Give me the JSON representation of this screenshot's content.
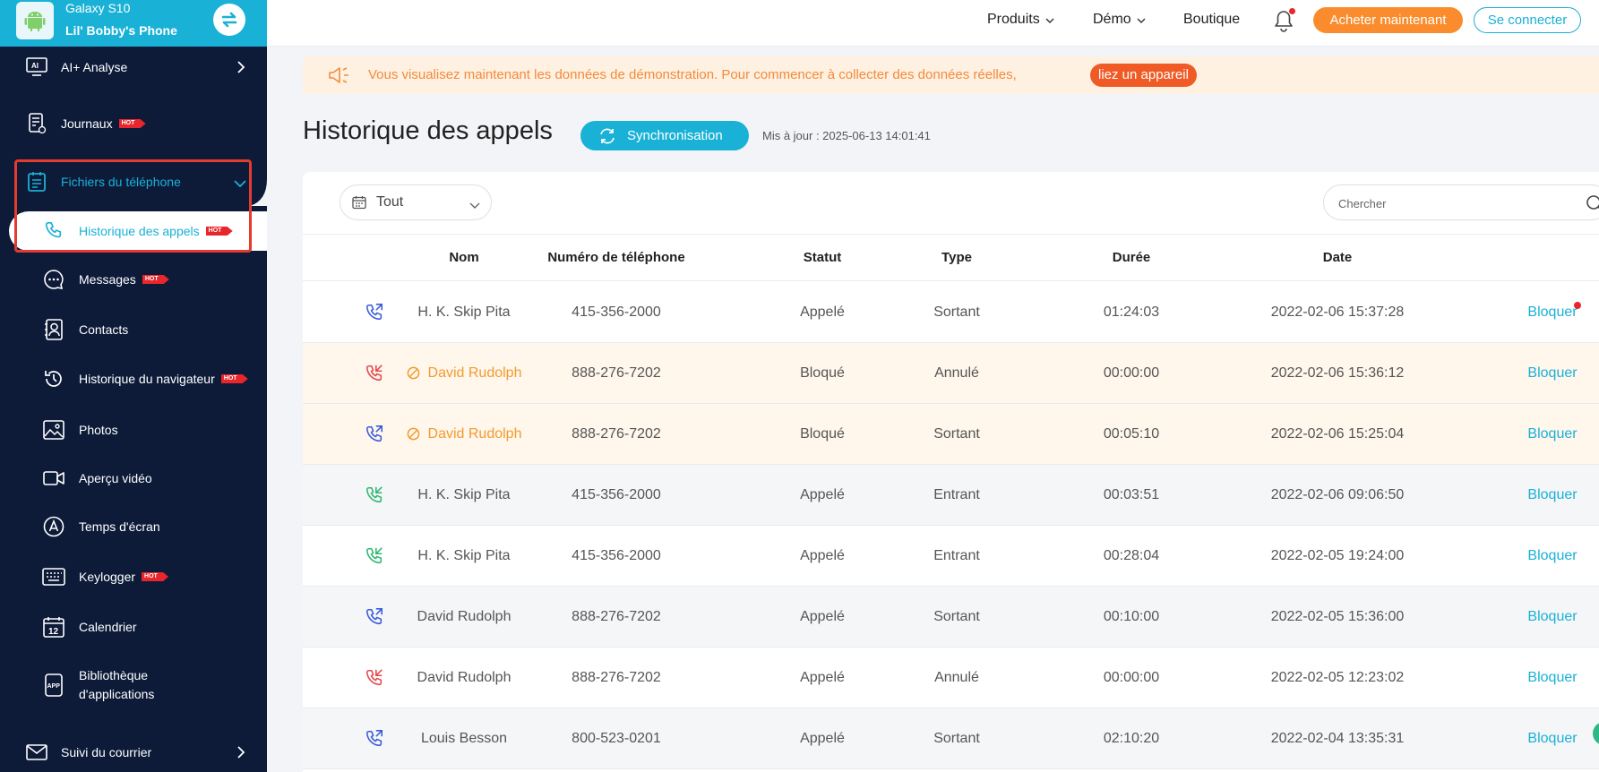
{
  "device": {
    "model": "Galaxy S10",
    "name": "Lil' Bobby's Phone"
  },
  "sidebar": {
    "hot_label": "HOT",
    "ai": "AI+ Analyse",
    "logs": "Journaux",
    "phone_files": "Fichiers du téléphone",
    "sub": {
      "calls": "Historique des appels",
      "messages": "Messages",
      "contacts": "Contacts",
      "browser": "Historique du navigateur",
      "photos": "Photos",
      "video": "Aperçu vidéo",
      "screen_time": "Temps d'écran",
      "keylogger": "Keylogger",
      "calendar": "Calendrier",
      "apps_line1": "Bibliothèque",
      "apps_line2": "d'applications"
    },
    "mail": "Suivi du courrier"
  },
  "topbar": {
    "products": "Produits",
    "demo": "Démo",
    "shop": "Boutique",
    "buy": "Acheter maintenant",
    "login": "Se connecter"
  },
  "banner": {
    "text": "Vous visualisez maintenant les données de démonstration. Pour commencer à collecter des données réelles,",
    "link": "liez un appareil"
  },
  "page": {
    "title": "Historique des appels",
    "sync": "Synchronisation",
    "updated": "Mis à jour : 2025-06-13 14:01:41"
  },
  "filter": {
    "selected": "Tout"
  },
  "search": {
    "placeholder": "Chercher"
  },
  "table": {
    "headers": {
      "name": "Nom",
      "phone": "Numéro de téléphone",
      "status": "Statut",
      "type": "Type",
      "duration": "Durée",
      "date": "Date"
    },
    "action_label": "Bloquer",
    "rows": [
      {
        "dir": "outgoing",
        "name": "H. K. Skip Pita",
        "phone": "415-356-2000",
        "status": "Appelé",
        "type": "Sortant",
        "duration": "01:24:03",
        "date": "2022-02-06 15:37:28",
        "blocked": false
      },
      {
        "dir": "cancelled",
        "name": "David Rudolph",
        "phone": "888-276-7202",
        "status": "Bloqué",
        "type": "Annulé",
        "duration": "00:00:00",
        "date": "2022-02-06 15:36:12",
        "blocked": true
      },
      {
        "dir": "outgoing",
        "name": "David Rudolph",
        "phone": "888-276-7202",
        "status": "Bloqué",
        "type": "Sortant",
        "duration": "00:05:10",
        "date": "2022-02-06 15:25:04",
        "blocked": true
      },
      {
        "dir": "incoming",
        "name": "H. K. Skip Pita",
        "phone": "415-356-2000",
        "status": "Appelé",
        "type": "Entrant",
        "duration": "00:03:51",
        "date": "2022-02-06 09:06:50",
        "blocked": false
      },
      {
        "dir": "incoming",
        "name": "H. K. Skip Pita",
        "phone": "415-356-2000",
        "status": "Appelé",
        "type": "Entrant",
        "duration": "00:28:04",
        "date": "2022-02-05 19:24:00",
        "blocked": false
      },
      {
        "dir": "outgoing",
        "name": "David Rudolph",
        "phone": "888-276-7202",
        "status": "Appelé",
        "type": "Sortant",
        "duration": "00:10:00",
        "date": "2022-02-05 15:36:00",
        "blocked": false
      },
      {
        "dir": "cancelled",
        "name": "David Rudolph",
        "phone": "888-276-7202",
        "status": "Appelé",
        "type": "Annulé",
        "duration": "00:00:00",
        "date": "2022-02-05 12:23:02",
        "blocked": false
      },
      {
        "dir": "outgoing",
        "name": "Louis Besson",
        "phone": "800-523-0201",
        "status": "Appelé",
        "type": "Sortant",
        "duration": "02:10:20",
        "date": "2022-02-04 13:35:31",
        "blocked": false
      }
    ]
  },
  "colors": {
    "accent": "#1ab1d6",
    "sidebar_bg": "#0d1b39",
    "orange": "#fb8c2d",
    "blocked_text": "#f39b2e",
    "outgoing_icon": "#3b5bdb",
    "incoming_icon": "#2eb872",
    "cancelled_icon": "#e5484d"
  }
}
